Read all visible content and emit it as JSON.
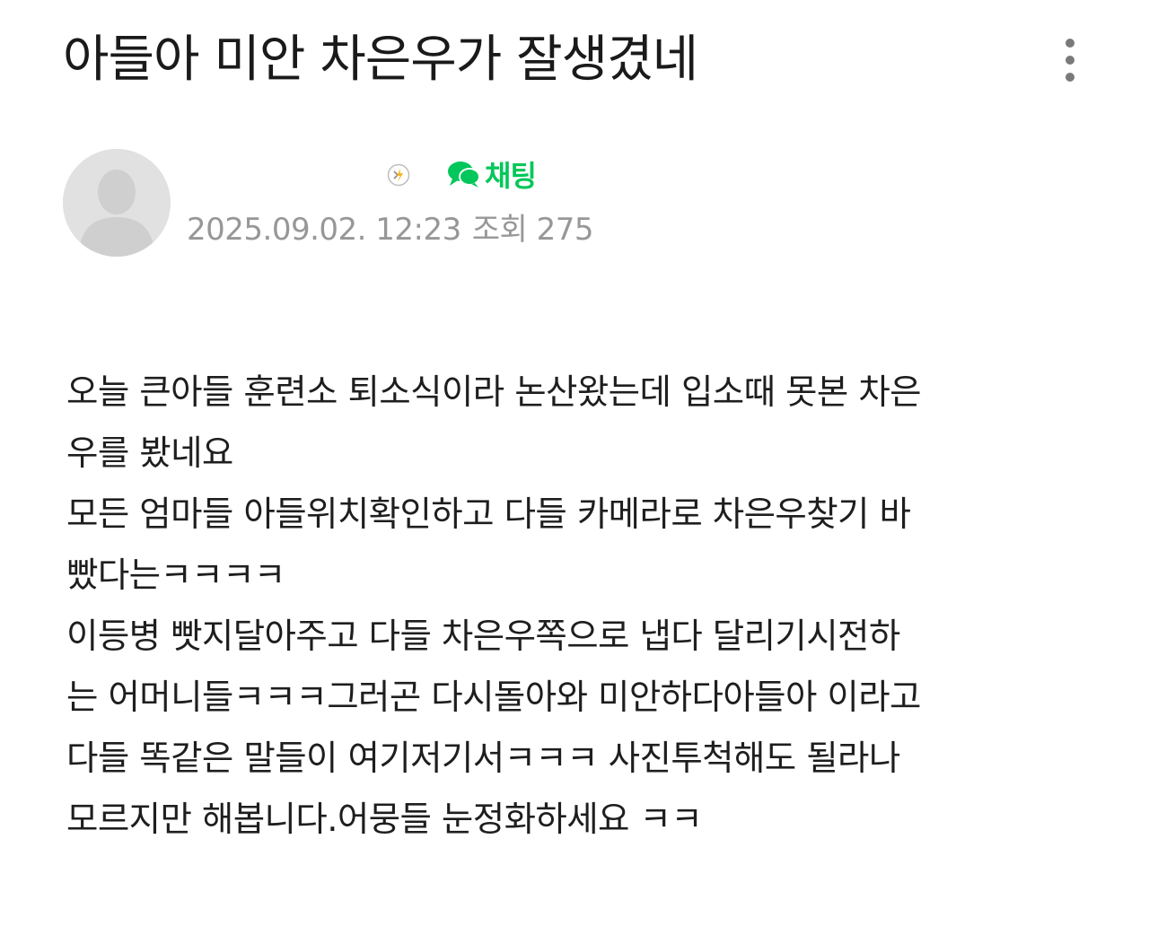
{
  "post": {
    "title": "아들아 미안 차은우가 잘생겼네",
    "meta": {
      "date": "2025.09.02. 12:23",
      "views_label": "조회",
      "views_count": "275"
    },
    "author": {
      "chat_label": "채팅"
    },
    "body_lines": [
      "오늘 큰아들 훈련소 퇴소식이라 논산왔는데 입소때 못본 차은",
      "우를 봤네요",
      "모든 엄마들 아들위치확인하고 다들 카메라로 차은우찾기 바",
      "빴다는ㅋㅋㅋㅋ",
      "이등병 빳지달아주고 다들 차은우쪽으로 냅다 달리기시전하",
      "는 어머니들ㅋㅋㅋ그러곤 다시돌아와 미안하다아들아 이라고",
      "다들 똑같은 말들이 여기저기서ㅋㅋㅋ 사진투척해도 될라나",
      "모르지만 해봅니다.어뭉들 눈정화하세요 ㅋㅋ"
    ]
  },
  "icons": {
    "more": "more-vertical-icon",
    "avatar": "default-avatar-icon",
    "level": "member-level-icon",
    "chat": "chat-bubble-icon"
  },
  "colors": {
    "chat_green": "#03c75a",
    "meta_gray": "#979797",
    "avatar_bg": "#e1e1e1"
  }
}
